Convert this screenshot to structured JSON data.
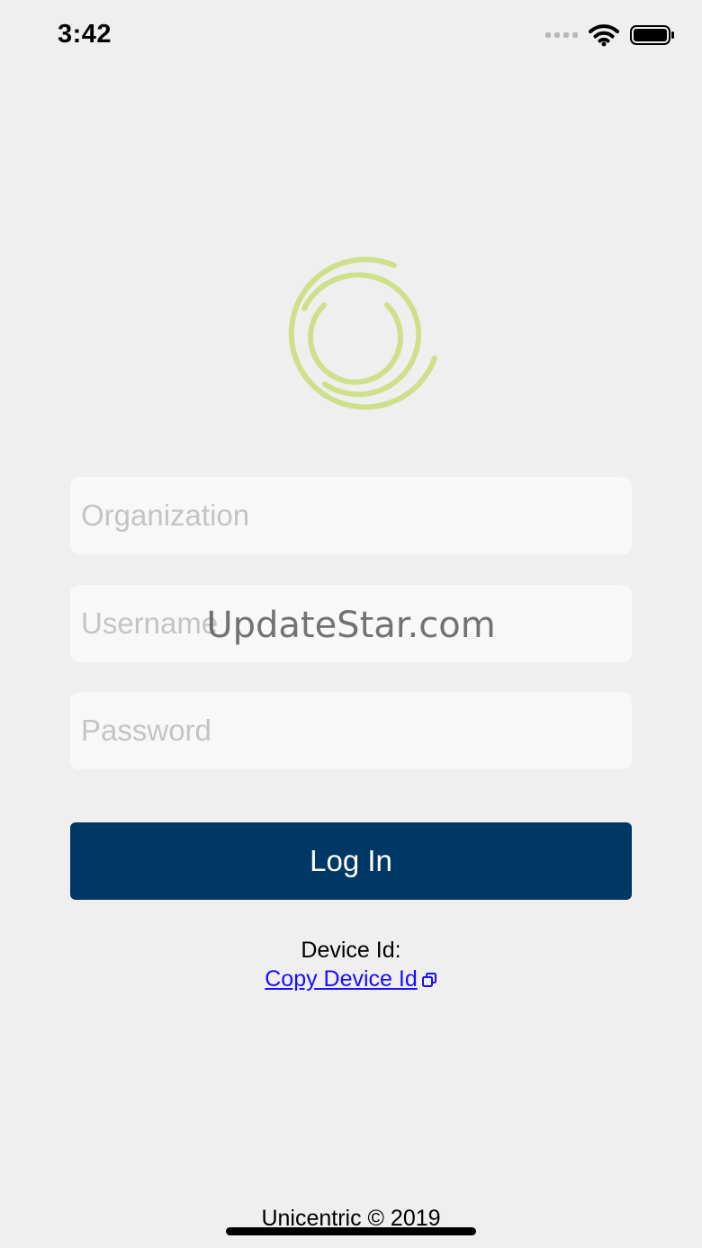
{
  "status_bar": {
    "time": "3:42"
  },
  "login_form": {
    "organization_placeholder": "Organization",
    "username_placeholder": "Username",
    "password_placeholder": "Password",
    "login_label": "Log In"
  },
  "watermark": "UpdateStar.com",
  "device": {
    "label": "Device Id:",
    "copy_label": "Copy Device Id"
  },
  "footer": {
    "text": "Unicentric © 2019"
  },
  "colors": {
    "background": "#efefef",
    "button": "#003865",
    "logo": "#cfe08a",
    "link": "#1a0dff"
  }
}
